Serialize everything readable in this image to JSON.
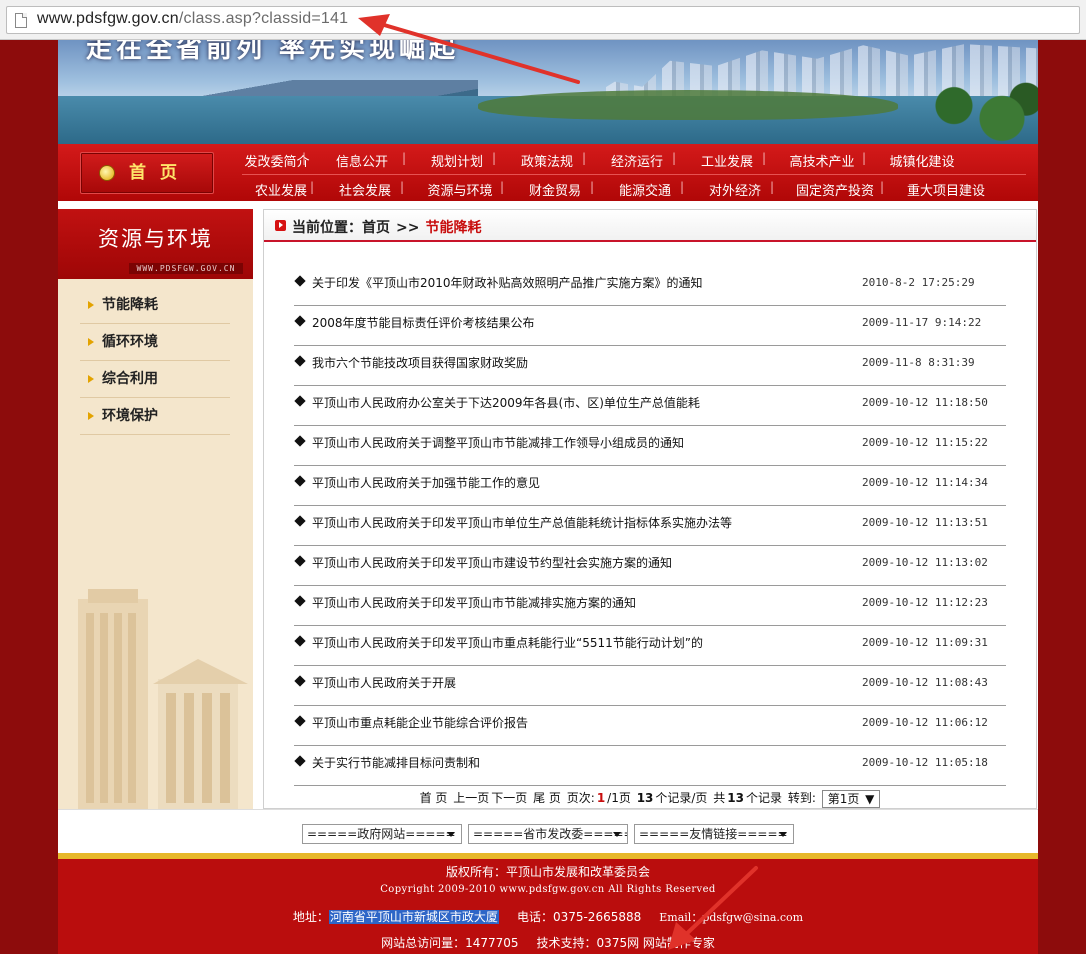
{
  "browser": {
    "url_host": "www.pdsfgw.gov.cn",
    "url_path": "/class.asp?classid=141"
  },
  "banner": {
    "slogan": "走在全省前列 率先实现崛起"
  },
  "nav": {
    "home_label": "首页",
    "row1": [
      "发改委简介",
      "信息公开",
      "规划计划",
      "政策法规",
      "经济运行",
      "工业发展",
      "高技术产业",
      "城镇化建设"
    ],
    "row2": [
      "农业发展",
      "社会发展",
      "资源与环境",
      "财金贸易",
      "能源交通",
      "对外经济",
      "固定资产投资",
      "重大项目建设"
    ]
  },
  "sidebar": {
    "title": "资源与环境",
    "site_url": "WWW.PDSFGW.GOV.CN",
    "items": [
      "节能降耗",
      "循环环境",
      "综合利用",
      "环境保护"
    ]
  },
  "breadcrumb": {
    "prefix": "当前位置：",
    "home": "首页",
    "separator": ">>",
    "current": "节能降耗"
  },
  "articles": [
    {
      "title": "关于印发《平顶山市2010年财政补贴高效照明产品推广实施方案》的通知",
      "date": "2010-8-2 17:25:29"
    },
    {
      "title": "2008年度节能目标责任评价考核结果公布",
      "date": "2009-11-17 9:14:22"
    },
    {
      "title": "我市六个节能技改项目获得国家财政奖励",
      "date": "2009-11-8 8:31:39"
    },
    {
      "title": "平顶山市人民政府办公室关于下达2009年各县(市、区)单位生产总值能耗",
      "date": "2009-10-12 11:18:50"
    },
    {
      "title": "平顶山市人民政府关于调整平顶山市节能减排工作领导小组成员的通知",
      "date": "2009-10-12 11:15:22"
    },
    {
      "title": "平顶山市人民政府关于加强节能工作的意见",
      "date": "2009-10-12 11:14:34"
    },
    {
      "title": "平顶山市人民政府关于印发平顶山市单位生产总值能耗统计指标体系实施办法等",
      "date": "2009-10-12 11:13:51"
    },
    {
      "title": "平顶山市人民政府关于印发平顶山市建设节约型社会实施方案的通知",
      "date": "2009-10-12 11:13:02"
    },
    {
      "title": "平顶山市人民政府关于印发平顶山市节能减排实施方案的通知",
      "date": "2009-10-12 11:12:23"
    },
    {
      "title": "平顶山市人民政府关于印发平顶山市重点耗能行业“5511节能行动计划”的",
      "date": "2009-10-12 11:09:31"
    },
    {
      "title": "平顶山市人民政府关于开展",
      "date": "2009-10-12 11:08:43"
    },
    {
      "title": "平顶山市重点耗能企业节能综合评价报告",
      "date": "2009-10-12 11:06:12"
    },
    {
      "title": "关于实行节能减排目标问责制和",
      "date": "2009-10-12 11:05:18"
    }
  ],
  "pager": {
    "first": "首 页",
    "prev": "上一页",
    "next": "下一页",
    "last": "尾 页",
    "pages_label": "页次:",
    "current_page": "1",
    "total_pages": "/1页",
    "per_page": "13",
    "per_page_suffix": "个记录/页",
    "total_prefix": "共",
    "total_records": "13",
    "total_suffix": "个记录",
    "goto_label": "转到:",
    "goto_value": "第1页"
  },
  "links": {
    "gov_sites": "=====政府网站=====",
    "provincial": "=====省市发改委=====",
    "friends": "=====友情链接====="
  },
  "footer": {
    "copyright_cn": "版权所有：平顶山市发展和改革委员会",
    "copyright_en": "Copyright 2009-2010 www.pdsfgw.gov.cn All Rights Reserved",
    "address_label": "地址：",
    "address": "河南省平顶山市新城区市政大厦",
    "phone": "电话：0375-2665888",
    "email": "Email：pdsfgw@sina.com",
    "visits": "网站总访问量：1477705",
    "support": "技术支持：0375网 网站制作专家"
  },
  "colors": {
    "accent_red": "#b00707",
    "breadcrumb_current": "#c80d0d",
    "highlight_blue": "#2e66c7",
    "annotation_red": "#e0322a"
  }
}
